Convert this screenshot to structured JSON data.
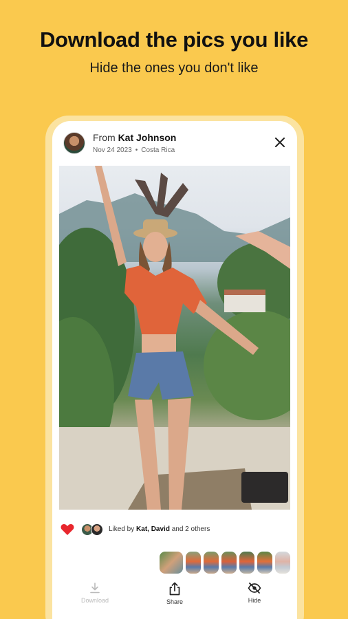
{
  "headline": "Download the pics you like",
  "subline": "Hide the ones you don't like",
  "post": {
    "from_prefix": "From",
    "from_name": "Kat Johnson",
    "date": "Nov 24 2023",
    "location": "Costa Rica",
    "separator": "•"
  },
  "likes": {
    "prefix": "Liked by",
    "names": "Kat, David",
    "suffix": "and 2 others"
  },
  "toolbar": {
    "download": "Download",
    "share": "Share",
    "hide": "Hide"
  },
  "colors": {
    "background": "#FAC94E",
    "heart": "#E8262D",
    "disabled": "#BBBBBB"
  },
  "icons": [
    "close-icon",
    "heart-icon",
    "download-icon",
    "share-icon",
    "hide-eye-icon"
  ]
}
